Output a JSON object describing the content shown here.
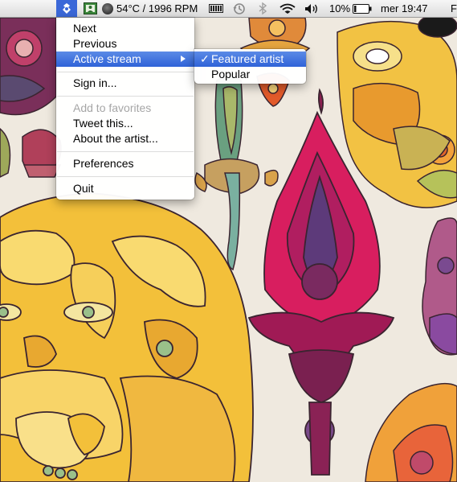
{
  "menubar": {
    "temperature_fan": "54°C / 1996 RPM",
    "battery_percent": "10%",
    "clock": "mer 19:47",
    "spotlight_partial": "F"
  },
  "main_menu": {
    "items": [
      {
        "label": "Next"
      },
      {
        "label": "Previous"
      },
      {
        "label": "Active stream"
      },
      {
        "label": "Sign in..."
      },
      {
        "label": "Add to favorites"
      },
      {
        "label": "Tweet this..."
      },
      {
        "label": "About the artist..."
      },
      {
        "label": "Preferences"
      },
      {
        "label": "Quit"
      }
    ]
  },
  "submenu": {
    "check_mark": "✓",
    "items": [
      {
        "label": "Featured artist"
      },
      {
        "label": "Popular"
      }
    ]
  },
  "colors": {
    "highlight": "#3367d6",
    "wallpaper_bg": "#efe9df"
  }
}
